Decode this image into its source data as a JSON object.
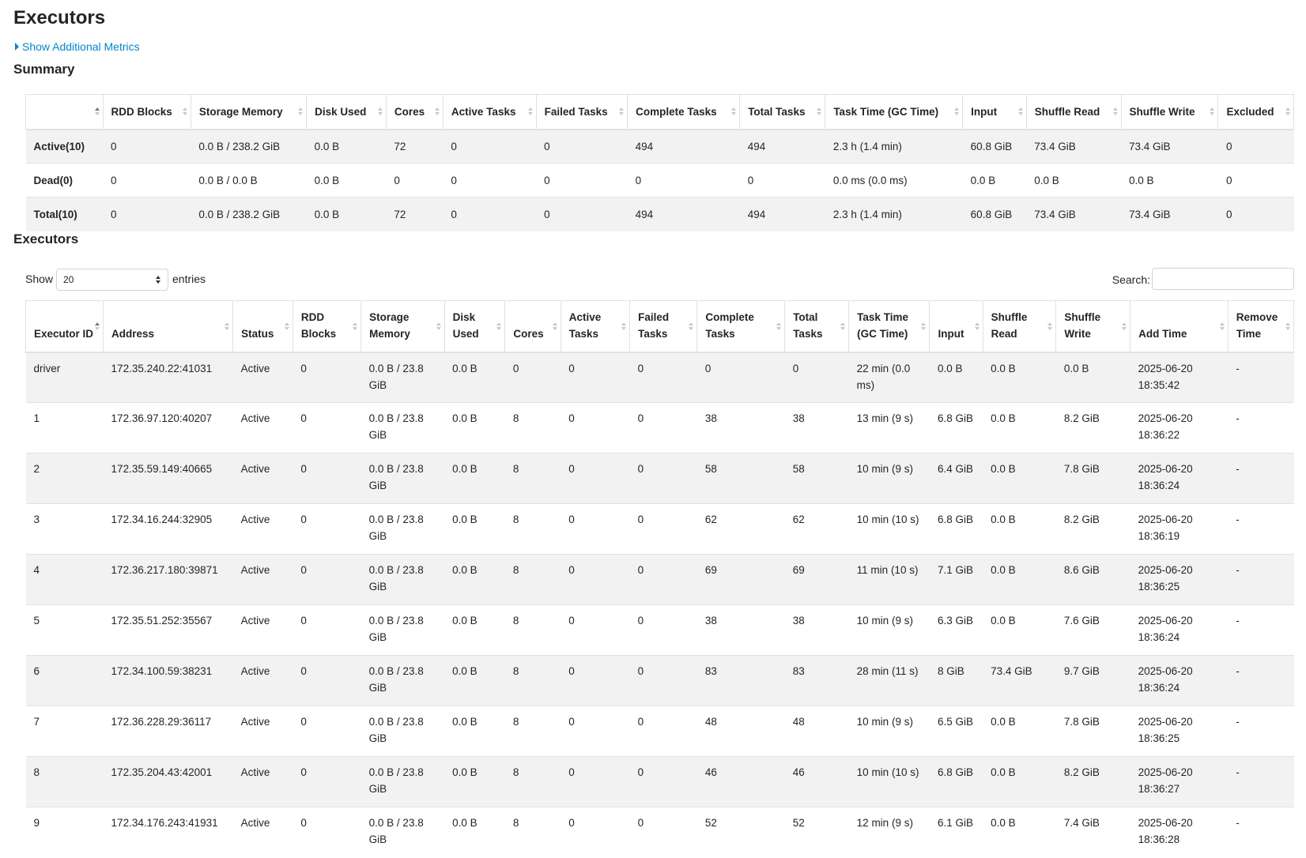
{
  "page": {
    "title": "Executors",
    "toggle_label": "Show Additional Metrics",
    "summary_title": "Summary",
    "executors_title": "Executors"
  },
  "summary": {
    "headers": [
      "",
      "RDD Blocks",
      "Storage Memory",
      "Disk Used",
      "Cores",
      "Active Tasks",
      "Failed Tasks",
      "Complete Tasks",
      "Total Tasks",
      "Task Time (GC Time)",
      "Input",
      "Shuffle Read",
      "Shuffle Write",
      "Excluded"
    ],
    "rows": [
      [
        "Active(10)",
        "0",
        "0.0 B / 238.2 GiB",
        "0.0 B",
        "72",
        "0",
        "0",
        "494",
        "494",
        "2.3 h (1.4 min)",
        "60.8 GiB",
        "73.4 GiB",
        "73.4 GiB",
        "0"
      ],
      [
        "Dead(0)",
        "0",
        "0.0 B / 0.0 B",
        "0.0 B",
        "0",
        "0",
        "0",
        "0",
        "0",
        "0.0 ms (0.0 ms)",
        "0.0 B",
        "0.0 B",
        "0.0 B",
        "0"
      ],
      [
        "Total(10)",
        "0",
        "0.0 B / 238.2 GiB",
        "0.0 B",
        "72",
        "0",
        "0",
        "494",
        "494",
        "2.3 h (1.4 min)",
        "60.8 GiB",
        "73.4 GiB",
        "73.4 GiB",
        "0"
      ]
    ]
  },
  "controls": {
    "show_label": "Show",
    "page_size": "20",
    "entries_label": "entries",
    "search_label": "Search:",
    "search_value": ""
  },
  "executors": {
    "headers": [
      "Executor ID",
      "Address",
      "Status",
      "RDD Blocks",
      "Storage Memory",
      "Disk Used",
      "Cores",
      "Active Tasks",
      "Failed Tasks",
      "Complete Tasks",
      "Total Tasks",
      "Task Time (GC Time)",
      "Input",
      "Shuffle Read",
      "Shuffle Write",
      "Add Time",
      "Remove Time"
    ],
    "rows": [
      [
        "driver",
        "172.35.240.22:41031",
        "Active",
        "0",
        "0.0 B / 23.8 GiB",
        "0.0 B",
        "0",
        "0",
        "0",
        "0",
        "0",
        "22 min (0.0 ms)",
        "0.0 B",
        "0.0 B",
        "0.0 B",
        "2025-06-20 18:35:42",
        "-"
      ],
      [
        "1",
        "172.36.97.120:40207",
        "Active",
        "0",
        "0.0 B / 23.8 GiB",
        "0.0 B",
        "8",
        "0",
        "0",
        "38",
        "38",
        "13 min (9 s)",
        "6.8 GiB",
        "0.0 B",
        "8.2 GiB",
        "2025-06-20 18:36:22",
        "-"
      ],
      [
        "2",
        "172.35.59.149:40665",
        "Active",
        "0",
        "0.0 B / 23.8 GiB",
        "0.0 B",
        "8",
        "0",
        "0",
        "58",
        "58",
        "10 min (9 s)",
        "6.4 GiB",
        "0.0 B",
        "7.8 GiB",
        "2025-06-20 18:36:24",
        "-"
      ],
      [
        "3",
        "172.34.16.244:32905",
        "Active",
        "0",
        "0.0 B / 23.8 GiB",
        "0.0 B",
        "8",
        "0",
        "0",
        "62",
        "62",
        "10 min (10 s)",
        "6.8 GiB",
        "0.0 B",
        "8.2 GiB",
        "2025-06-20 18:36:19",
        "-"
      ],
      [
        "4",
        "172.36.217.180:39871",
        "Active",
        "0",
        "0.0 B / 23.8 GiB",
        "0.0 B",
        "8",
        "0",
        "0",
        "69",
        "69",
        "11 min (10 s)",
        "7.1 GiB",
        "0.0 B",
        "8.6 GiB",
        "2025-06-20 18:36:25",
        "-"
      ],
      [
        "5",
        "172.35.51.252:35567",
        "Active",
        "0",
        "0.0 B / 23.8 GiB",
        "0.0 B",
        "8",
        "0",
        "0",
        "38",
        "38",
        "10 min (9 s)",
        "6.3 GiB",
        "0.0 B",
        "7.6 GiB",
        "2025-06-20 18:36:24",
        "-"
      ],
      [
        "6",
        "172.34.100.59:38231",
        "Active",
        "0",
        "0.0 B / 23.8 GiB",
        "0.0 B",
        "8",
        "0",
        "0",
        "83",
        "83",
        "28 min (11 s)",
        "8 GiB",
        "73.4 GiB",
        "9.7 GiB",
        "2025-06-20 18:36:24",
        "-"
      ],
      [
        "7",
        "172.36.228.29:36117",
        "Active",
        "0",
        "0.0 B / 23.8 GiB",
        "0.0 B",
        "8",
        "0",
        "0",
        "48",
        "48",
        "10 min (9 s)",
        "6.5 GiB",
        "0.0 B",
        "7.8 GiB",
        "2025-06-20 18:36:25",
        "-"
      ],
      [
        "8",
        "172.35.204.43:42001",
        "Active",
        "0",
        "0.0 B / 23.8 GiB",
        "0.0 B",
        "8",
        "0",
        "0",
        "46",
        "46",
        "10 min (10 s)",
        "6.8 GiB",
        "0.0 B",
        "8.2 GiB",
        "2025-06-20 18:36:27",
        "-"
      ],
      [
        "9",
        "172.34.176.243:41931",
        "Active",
        "0",
        "0.0 B / 23.8 GiB",
        "0.0 B",
        "8",
        "0",
        "0",
        "52",
        "52",
        "12 min (9 s)",
        "6.1 GiB",
        "0.0 B",
        "7.4 GiB",
        "2025-06-20 18:36:28",
        "-"
      ]
    ]
  },
  "colors": {
    "link": "#0088cc",
    "stripe": "#f2f2f2",
    "border": "#dee2e6",
    "text": "#212529"
  },
  "icons": {
    "sort": "sort-arrows-icon",
    "toggle": "caret-right-icon",
    "select": "select-chevron-icon"
  }
}
